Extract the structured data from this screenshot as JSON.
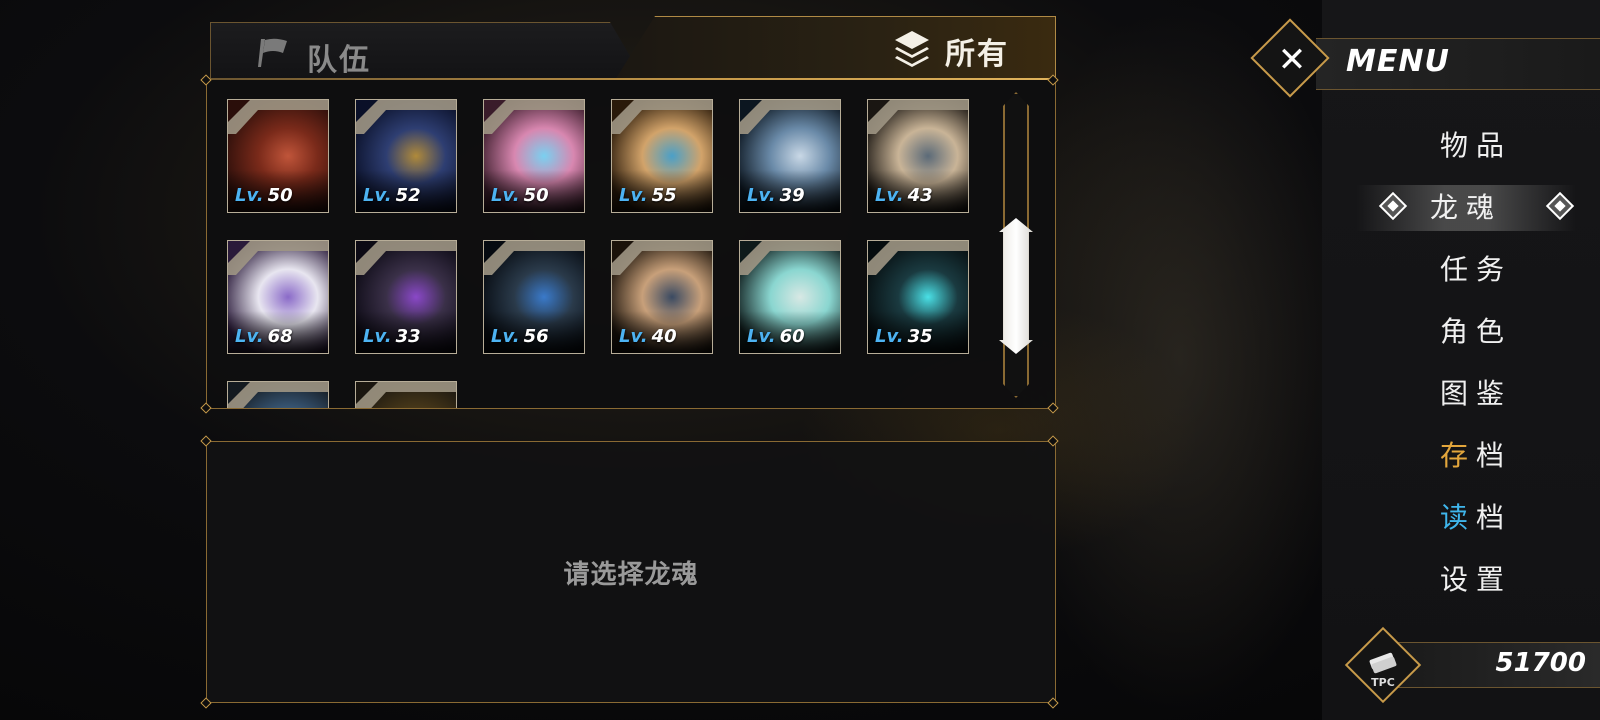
{
  "tabs": {
    "team_label": "队伍",
    "all_label": "所有"
  },
  "cards": [
    {
      "lv_prefix": "Lv.",
      "level": "50",
      "palette": [
        "#2a0e0a",
        "#7a2a1a",
        "#c0553a"
      ]
    },
    {
      "lv_prefix": "Lv.",
      "level": "52",
      "palette": [
        "#0a1028",
        "#2e3e72",
        "#b08a3a"
      ]
    },
    {
      "lv_prefix": "Lv.",
      "level": "50",
      "palette": [
        "#3a1c2a",
        "#d887b0",
        "#7ad0f0"
      ]
    },
    {
      "lv_prefix": "Lv.",
      "level": "55",
      "palette": [
        "#2a1a0a",
        "#d2a36a",
        "#4aa0c8"
      ]
    },
    {
      "lv_prefix": "Lv.",
      "level": "39",
      "palette": [
        "#0c1620",
        "#6a8aa8",
        "#c9d8e6"
      ]
    },
    {
      "lv_prefix": "Lv.",
      "level": "43",
      "palette": [
        "#1a1612",
        "#c9b497",
        "#5b6a78"
      ]
    },
    {
      "lv_prefix": "Lv.",
      "level": "68",
      "palette": [
        "#2a1a3a",
        "#e8e6f0",
        "#8a6ac8"
      ]
    },
    {
      "lv_prefix": "Lv.",
      "level": "33",
      "palette": [
        "#0c0a14",
        "#3a3048",
        "#8a48c8"
      ]
    },
    {
      "lv_prefix": "Lv.",
      "level": "56",
      "palette": [
        "#060a10",
        "#2a3a4a",
        "#3a7aca"
      ]
    },
    {
      "lv_prefix": "Lv.",
      "level": "40",
      "palette": [
        "#1a120a",
        "#c8a07a",
        "#3a4a62"
      ]
    },
    {
      "lv_prefix": "Lv.",
      "level": "60",
      "palette": [
        "#0e1a1a",
        "#8ad6d0",
        "#d8e8e4"
      ]
    },
    {
      "lv_prefix": "Lv.",
      "level": "35",
      "palette": [
        "#060c0e",
        "#1a3a40",
        "#4ae0e6"
      ]
    },
    {
      "lv_prefix": "",
      "level": "",
      "palette": [
        "#141a20",
        "#3a5a7a",
        "#6a8ab0"
      ]
    },
    {
      "lv_prefix": "",
      "level": "",
      "palette": [
        "#1a1610",
        "#4a3a1a",
        "#c8a83a"
      ]
    }
  ],
  "detail": {
    "hint": "请选择龙魂"
  },
  "menu": {
    "title": "MENU",
    "items": [
      {
        "label": "物品"
      },
      {
        "label": "龙魂"
      },
      {
        "label": "任务"
      },
      {
        "label": "角色"
      },
      {
        "label": "图鉴"
      },
      {
        "label_a": "存",
        "label_b": "档"
      },
      {
        "label_a": "读",
        "label_b": "档"
      },
      {
        "label": "设置"
      }
    ]
  },
  "currency": {
    "icon_text": "TPC",
    "value": "51700"
  },
  "colors": {
    "gold": "#c79a4a",
    "level_prefix": "#4db3f2",
    "save_accent": "#e3a63c",
    "load_accent": "#3fb6ec"
  }
}
